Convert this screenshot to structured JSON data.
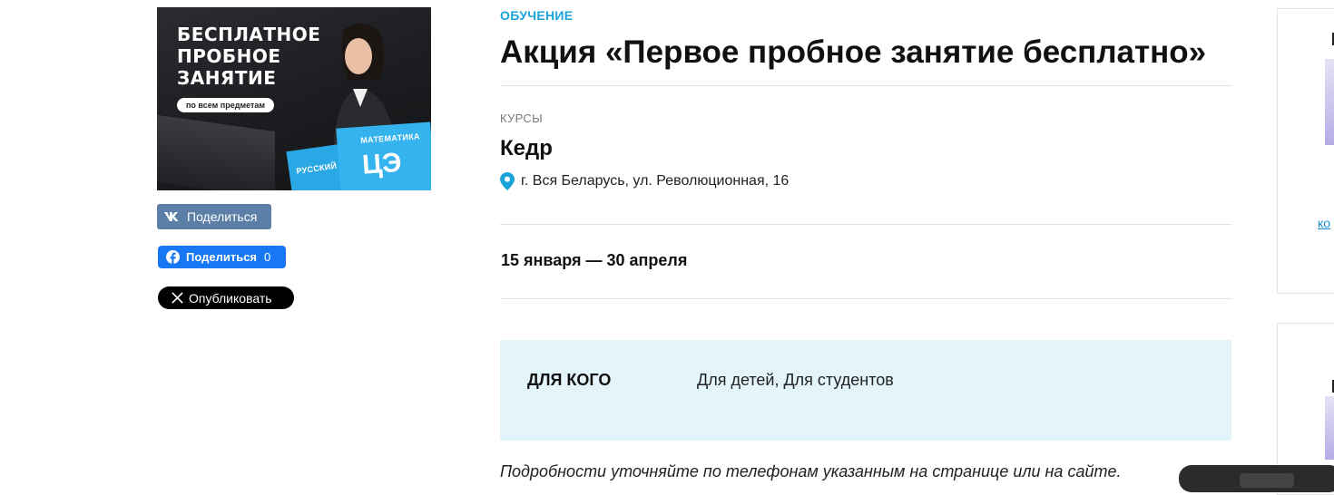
{
  "poster": {
    "title": "БЕСПЛАТНОЕ\nПРОБНОЕ\nЗАНЯТИЕ",
    "pill": "по всем предметам",
    "book_math": "МАТЕМАТИКА",
    "book_russian": "РУССКИЙ",
    "book_big": "ЦЭ"
  },
  "share": {
    "vk_label": "Поделиться",
    "fb_label": "Поделиться",
    "fb_count": "0",
    "x_label": "Опубликовать"
  },
  "event": {
    "category": "ОБУЧЕНИЕ",
    "title": "Акция «Первое пробное занятие бесплатно»",
    "subcategory": "КУРСЫ",
    "organization": "Кедр",
    "address": "г. Вся Беларусь, ул. Революционная, 16",
    "dates": "15 января — 30 апреля",
    "audience_label": "ДЛЯ КОГО",
    "audience_value": "Для детей, Для студентов",
    "note": "Подробности уточняйте по телефонам указанным на странице или на сайте."
  },
  "sidebar": {
    "link_text": "ко"
  },
  "colors": {
    "accent": "#1aa3d8",
    "info_bg": "#e3f4fb",
    "vk": "#5b7fa6",
    "fb": "#1877f2",
    "x": "#000000"
  }
}
